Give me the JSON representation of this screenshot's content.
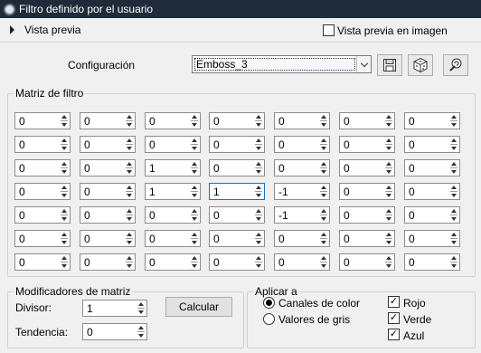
{
  "window": {
    "title": "Filtro definido por el usuario"
  },
  "preview": {
    "label": "Vista previa",
    "image_checkbox_label": "Vista previa en imagen",
    "image_checked": false
  },
  "config": {
    "label": "Configuración",
    "value": "Emboss_3",
    "icons": [
      "save-icon",
      "dice-icon",
      "reset-icon"
    ]
  },
  "matrix": {
    "legend": "Matriz de filtro",
    "rows": [
      [
        "0",
        "0",
        "0",
        "0",
        "0",
        "0",
        "0"
      ],
      [
        "0",
        "0",
        "0",
        "0",
        "0",
        "0",
        "0"
      ],
      [
        "0",
        "0",
        "1",
        "0",
        "0",
        "0",
        "0"
      ],
      [
        "0",
        "0",
        "1",
        "1",
        "-1",
        "0",
        "0"
      ],
      [
        "0",
        "0",
        "0",
        "0",
        "-1",
        "0",
        "0"
      ],
      [
        "0",
        "0",
        "0",
        "0",
        "0",
        "0",
        "0"
      ],
      [
        "0",
        "0",
        "0",
        "0",
        "0",
        "0",
        "0"
      ]
    ]
  },
  "modifiers": {
    "legend": "Modificadores de matriz",
    "divisor_label": "Divisor:",
    "divisor_value": "1",
    "bias_label": "Tendencia:",
    "bias_value": "0",
    "calc_label": "Calcular"
  },
  "apply": {
    "legend": "Aplicar a",
    "radio_color": "Canales de color",
    "radio_gray": "Valores de gris",
    "selected": "color",
    "red": "Rojo",
    "green": "Verde",
    "blue": "Azul",
    "red_checked": true,
    "green_checked": true,
    "blue_checked": true
  }
}
